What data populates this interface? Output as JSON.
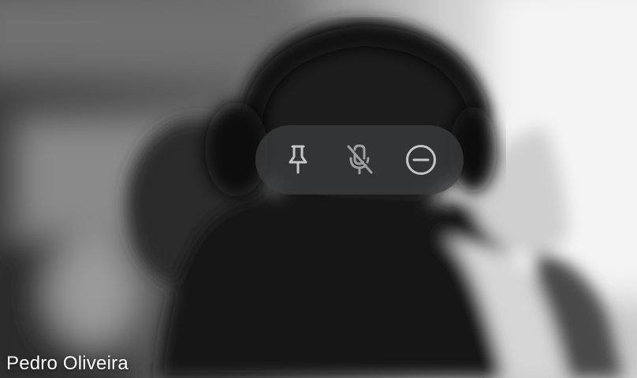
{
  "participant": {
    "name": "Pedro Oliveira"
  },
  "controls": {
    "items": [
      {
        "icon": "pin-icon"
      },
      {
        "icon": "mic-off-icon"
      },
      {
        "icon": "remove-icon"
      }
    ],
    "icon_color": "#c4c7c5"
  }
}
